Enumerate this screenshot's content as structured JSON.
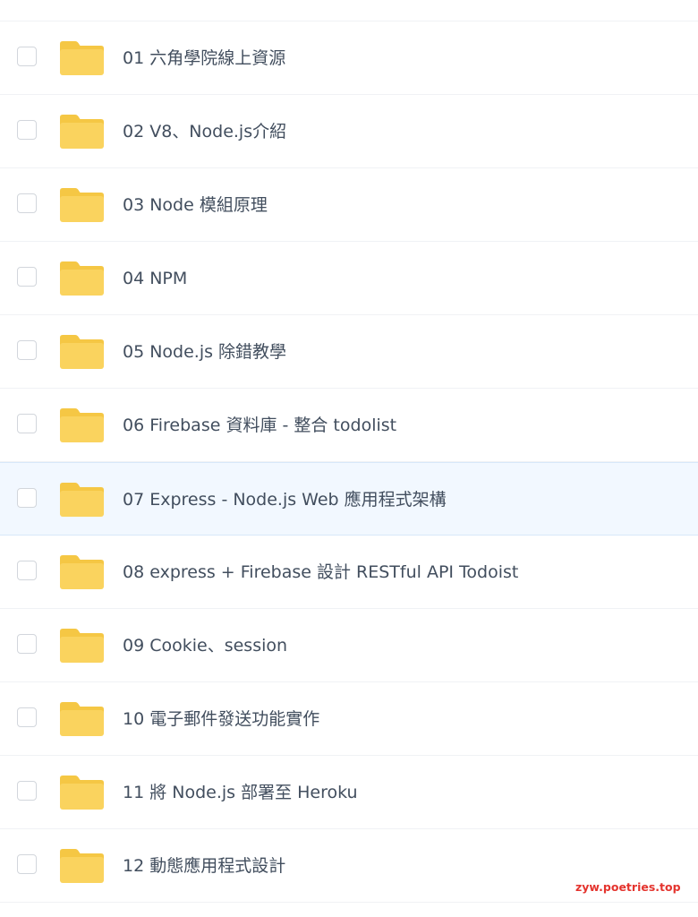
{
  "file_list": {
    "items": [
      {
        "name": "",
        "type": "folder",
        "selected": false,
        "checked": false,
        "partial": true
      },
      {
        "name": "01 六角學院線上資源",
        "type": "folder",
        "selected": false,
        "checked": false
      },
      {
        "name": "02 V8、Node.js介紹",
        "type": "folder",
        "selected": false,
        "checked": false
      },
      {
        "name": "03 Node 模組原理",
        "type": "folder",
        "selected": false,
        "checked": false
      },
      {
        "name": "04 NPM",
        "type": "folder",
        "selected": false,
        "checked": false
      },
      {
        "name": "05 Node.js 除錯教學",
        "type": "folder",
        "selected": false,
        "checked": false
      },
      {
        "name": "06 Firebase 資料庫 - 整合 todolist",
        "type": "folder",
        "selected": false,
        "checked": false
      },
      {
        "name": "07 Express - Node.js Web 應用程式架構",
        "type": "folder",
        "selected": true,
        "checked": false
      },
      {
        "name": "08 express + Firebase 設計 RESTful API Todoist",
        "type": "folder",
        "selected": false,
        "checked": false
      },
      {
        "name": "09 Cookie、session",
        "type": "folder",
        "selected": false,
        "checked": false
      },
      {
        "name": "10 電子郵件發送功能實作",
        "type": "folder",
        "selected": false,
        "checked": false
      },
      {
        "name": "11 將 Node.js 部署至 Heroku",
        "type": "folder",
        "selected": false,
        "checked": false
      },
      {
        "name": "12 動態應用程式設計",
        "type": "folder",
        "selected": false,
        "checked": false
      }
    ]
  },
  "icons": {
    "folder": "folder-icon",
    "checkbox": "checkbox-icon"
  },
  "colors": {
    "folder": "#fad35e",
    "folder_back": "#f5c744",
    "selected_row": "#f2f8ff",
    "text": "#424e5e",
    "watermark": "#e4342e"
  },
  "watermark": {
    "text": "zyw.poetries.top"
  }
}
